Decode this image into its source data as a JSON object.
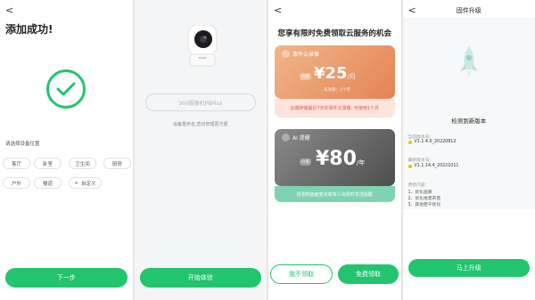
{
  "screen1": {
    "back": "<",
    "title": "添加成功!",
    "location_label": "请选择设备位置",
    "rooms": [
      "客厅",
      "卧室",
      "卫生间",
      "厨房",
      "户外",
      "楼道"
    ],
    "custom_label": "自定义",
    "next_label": "下一步"
  },
  "screen2": {
    "device_name": "360摄像机P8Max",
    "hint": "设备重命名,查找管理更方便",
    "start_label": "开始体验"
  },
  "screen3": {
    "back": "<",
    "title": "您享有限时免费领取云服务的机会",
    "card1": {
      "name": "事件云录像",
      "value_tag": "价值",
      "price": "¥25",
      "unit": "/月",
      "validity": "有效期：1个月",
      "desc": "云端存储最近7天的事件云录像, 可使用1个月"
    },
    "card2": {
      "name": "AI 提醒",
      "value_tag": "价值",
      "price": "¥80",
      "unit": "/年",
      "desc": "检测到画面变化或有人出现时发送提醒"
    },
    "decline_label": "我不领取",
    "claim_label": "免费领取"
  },
  "screen4": {
    "back": "<",
    "header": "固件升级",
    "status": "检测到新版本",
    "current_label": "当前版本号：",
    "current_version": "V1.1.4.0_20220812",
    "latest_label": "最新版本号：",
    "latest_version": "V1.1.14.4_20221011",
    "changes_label": "更新内容：",
    "changes": [
      "1、优化画质",
      "2、优化拾音声音",
      "3、其他若干优化"
    ],
    "upgrade_label": "马上升级"
  },
  "colors": {
    "accent": "#22c46e",
    "orange_card": "#e58355",
    "dark_card": "#4e4e4e",
    "dot": "#f5b90e"
  }
}
